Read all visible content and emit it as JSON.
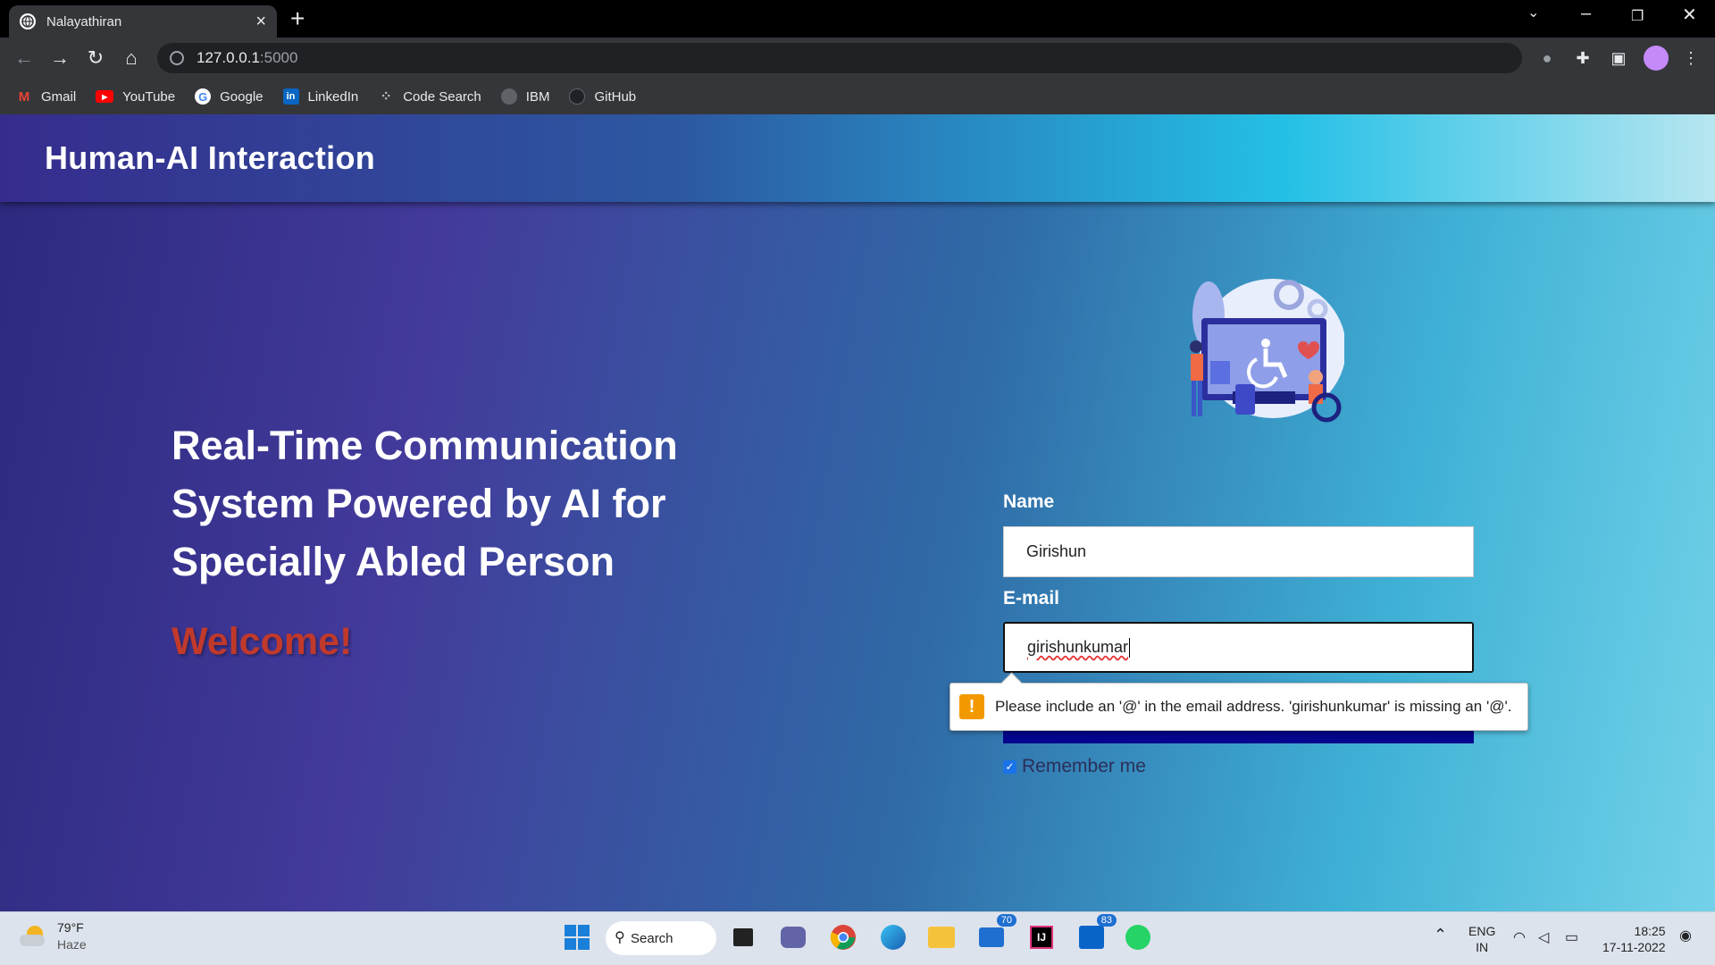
{
  "browser": {
    "tab_title": "Nalayathiran",
    "url_host": "127.0.0.1",
    "url_port": ":5000",
    "bookmarks": [
      {
        "label": "Gmail",
        "icon": "gmail-icon"
      },
      {
        "label": "YouTube",
        "icon": "youtube-icon"
      },
      {
        "label": "Google",
        "icon": "google-icon"
      },
      {
        "label": "LinkedIn",
        "icon": "linkedin-icon"
      },
      {
        "label": "Code Search",
        "icon": "code-search-icon"
      },
      {
        "label": "IBM",
        "icon": "globe-icon"
      },
      {
        "label": "GitHub",
        "icon": "github-icon"
      }
    ]
  },
  "page": {
    "brand": "Human-AI Interaction",
    "hero_title": "Real-Time Communication System Powered by AI for Specially Abled Person",
    "welcome": "Welcome!",
    "form": {
      "name_label": "Name",
      "name_value": "Girishun",
      "email_label": "E-mail",
      "email_value": "girishunkumar",
      "validation_message": "Please include an '@' in the email address. 'girishunkumar' is missing an '@'.",
      "remember_label": "Remember me",
      "remember_checked": true
    }
  },
  "taskbar": {
    "weather_temp": "79°F",
    "weather_desc": "Haze",
    "search_label": "Search",
    "mail_badge": "70",
    "outlook_badge": "83",
    "lang_line1": "ENG",
    "lang_line2": "IN",
    "time": "18:25",
    "date": "17-11-2022"
  },
  "colors": {
    "welcome": "#c0392b",
    "submit_button": "#05068d",
    "warning": "#f29900"
  }
}
